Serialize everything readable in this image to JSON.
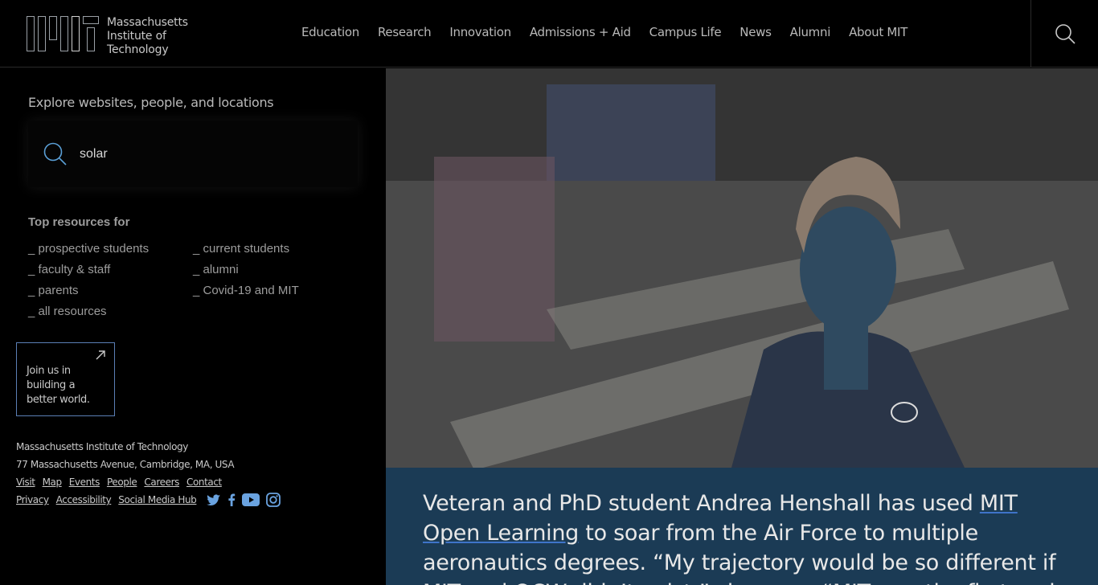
{
  "header": {
    "logo_lines": [
      "Massachusetts",
      "Institute of",
      "Technology"
    ],
    "nav": [
      "Education",
      "Research",
      "Innovation",
      "Admissions + Aid",
      "Campus Life",
      "News",
      "Alumni",
      "About MIT"
    ],
    "search_icon": "search-icon"
  },
  "sidebar": {
    "explore_label": "Explore websites, people, and locations",
    "search_value": "solar",
    "resources_title": "Top resources for",
    "resources": [
      "_ prospective students",
      "_ current students",
      "_ faculty & staff",
      "_ alumni",
      "_ parents",
      "_ Covid-19 and MIT",
      "_ all resources"
    ]
  },
  "join": {
    "lines": [
      "Join us in",
      "building a",
      "better world."
    ],
    "icon": "arrow-up-right-icon"
  },
  "footer": {
    "institute": "Massachusetts Institute of Technology",
    "address": "77 Massachusetts Avenue, Cambridge, MA, USA",
    "links_row1": [
      "Visit",
      "Map",
      "Events",
      "People",
      "Careers",
      "Contact"
    ],
    "links_row2": [
      "Privacy",
      "Accessibility",
      "Social Media Hub"
    ],
    "social_icons": [
      "twitter-icon",
      "facebook-icon",
      "youtube-icon",
      "instagram-icon"
    ]
  },
  "caption": {
    "part1": "Veteran and PhD student Andrea Henshall has used ",
    "link": "MIT Open Learning",
    "part2": " to soar from the Air Force to multiple aeronautics degrees. “My trajectory would be so different if MIT and OCW didn’t exist,” she says. “MIT was the first and"
  },
  "colors": {
    "background": "#000000",
    "caption_bg": "#1b3b55",
    "accent_link": "#3f74c9",
    "join_border": "#5b7fb5"
  }
}
